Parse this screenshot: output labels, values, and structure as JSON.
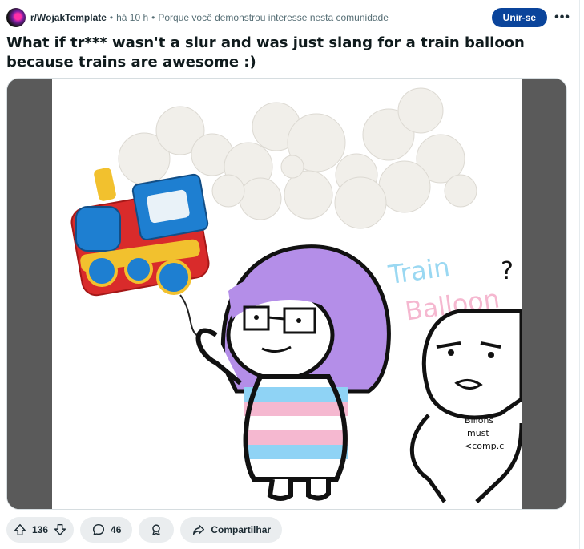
{
  "post": {
    "subreddit": "r/WojakTemplate",
    "separator": "•",
    "time": "há 10 h",
    "recommendation": "Porque você demonstrou interesse nesta comunidade",
    "join_label": "Unir-se",
    "more_label": "•••",
    "title": "What if tr*** wasn't a slur and was just slang for a train balloon because trains are awesome :)"
  },
  "image": {
    "text_train": "Train",
    "text_balloon": "Balloon",
    "question_mark": "?",
    "shirt_line1": "Billons",
    "shirt_line2": "must",
    "shirt_line3": "<comp.c"
  },
  "actions": {
    "upvote_count": "136",
    "comment_count": "46",
    "share_label": "Compartilhar"
  },
  "colors": {
    "join_button": "#0a449b",
    "pill_background": "#eaedef",
    "hair": "#b48ee8",
    "trans_blue": "#8fd3f5",
    "trans_pink": "#f5b8d0"
  },
  "icons": [
    "subreddit-avatar",
    "more-icon",
    "upvote-icon",
    "downvote-icon",
    "comment-icon",
    "award-icon",
    "share-icon"
  ]
}
